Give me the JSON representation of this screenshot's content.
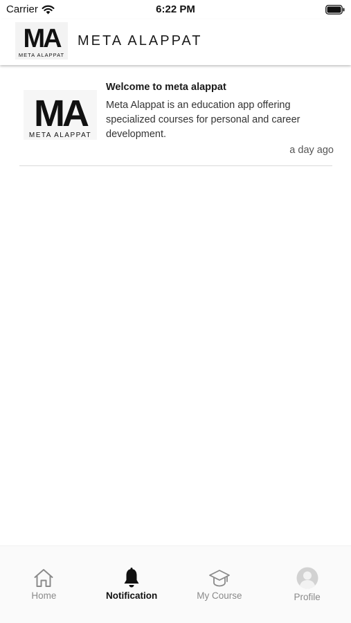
{
  "status_bar": {
    "carrier": "Carrier",
    "time": "6:22 PM",
    "wifi_icon": "wifi-icon",
    "battery_icon": "battery-icon"
  },
  "header": {
    "logo_monogram": "MA",
    "logo_text": "META ALAPPAT",
    "title": "META ALAPPAT"
  },
  "notifications": [
    {
      "title": "Welcome to meta alappat",
      "body": "Meta Alappat is an education app offering specialized courses for personal and career development.",
      "time": "a day ago",
      "logo_text": "META ALAPPAT"
    }
  ],
  "tab_bar": {
    "active": "notification",
    "tabs": [
      {
        "id": "home",
        "label": "Home",
        "icon": "home-icon"
      },
      {
        "id": "notification",
        "label": "Notification",
        "icon": "bell-icon"
      },
      {
        "id": "my_course",
        "label": "My Course",
        "icon": "graduation-cap-icon"
      },
      {
        "id": "profile",
        "label": "Profile",
        "icon": "avatar-icon"
      }
    ]
  },
  "colors": {
    "active_tab": "#111111",
    "inactive_tab": "#8a8a8a",
    "divider": "#d9d9d9",
    "header_text": "#1a1a1a"
  }
}
